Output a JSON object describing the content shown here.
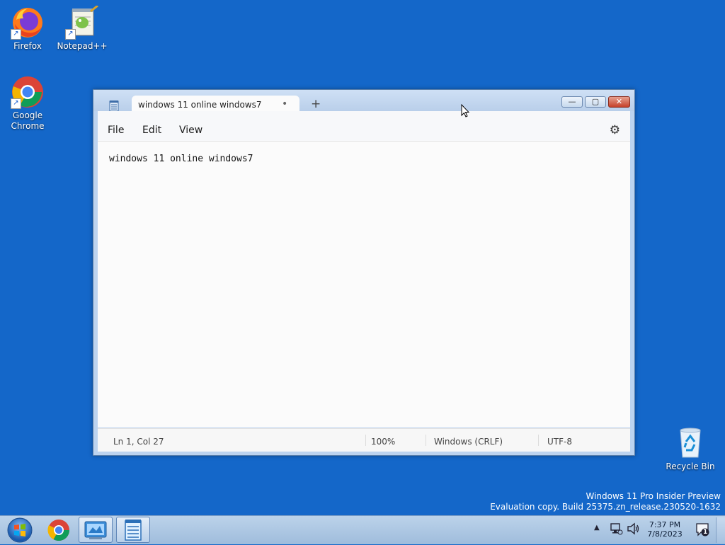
{
  "desktop": {
    "icons": [
      {
        "label": "Firefox"
      },
      {
        "label": "Notepad++"
      },
      {
        "label": "Google Chrome"
      },
      {
        "label": "Recycle Bin"
      }
    ]
  },
  "window": {
    "tab_title": "windows 11 online windows7",
    "tab_modified_dot": "•",
    "new_tab": "+",
    "controls": {
      "minimize": "—",
      "maximize": "▢",
      "close": "✕"
    },
    "menu": [
      "File",
      "Edit",
      "View"
    ],
    "content": "windows 11 online windows7",
    "status": {
      "position": "Ln 1, Col 27",
      "zoom": "100%",
      "line_endings": "Windows (CRLF)",
      "encoding": "UTF-8"
    }
  },
  "watermark": {
    "line1": "Windows 11 Pro Insider Preview",
    "line2": "Evaluation copy. Build 25375.zn_release.230520-1632"
  },
  "taskbar": {
    "clock_time": "7:37 PM",
    "clock_date": "7/8/2023",
    "notification_count": "1"
  }
}
